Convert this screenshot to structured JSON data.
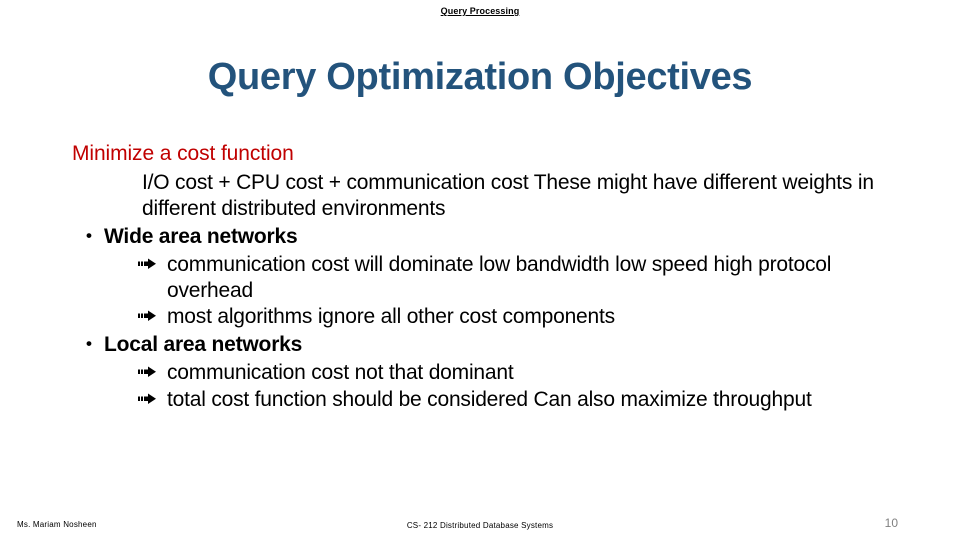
{
  "slide": {
    "header": "Query Processing",
    "title": "Query Optimization Objectives",
    "colors": {
      "title": "#23537C",
      "accent_red": "#C00000",
      "body_text": "#000000",
      "page_number": "#808080",
      "background": "#FFFFFF"
    },
    "content": [
      {
        "level": 1,
        "kind": "lead",
        "text": "Minimize a cost function"
      },
      {
        "level": 2,
        "kind": "plain",
        "text": "I/O cost + CPU cost + communication cost These might have different weights in different distributed environments"
      },
      {
        "level": 1,
        "kind": "bullet",
        "marker": "bullet-dot",
        "marker_glyph": "•",
        "text": "Wide area networks"
      },
      {
        "level": 2,
        "kind": "arrow",
        "marker": "arrow-right",
        "marker_glyph": "⇨",
        "text": "communication cost will dominate low bandwidth low speed high protocol overhead"
      },
      {
        "level": 2,
        "kind": "arrow",
        "marker": "arrow-right",
        "marker_glyph": "⇨",
        "text": "most algorithms ignore all other cost components"
      },
      {
        "level": 1,
        "kind": "bullet",
        "marker": "bullet-dot",
        "marker_glyph": "•",
        "text": "Local area networks"
      },
      {
        "level": 2,
        "kind": "arrow",
        "marker": "arrow-right",
        "marker_glyph": "⇨",
        "text": "communication cost not that dominant"
      },
      {
        "level": 2,
        "kind": "arrow",
        "marker": "arrow-right",
        "marker_glyph": "⇨",
        "text": "total cost function should be considered Can also maximize throughput"
      }
    ],
    "footer": {
      "author": "Ms. Mariam Nosheen",
      "course": "CS- 212 Distributed Database Systems",
      "page_number": "10"
    }
  }
}
